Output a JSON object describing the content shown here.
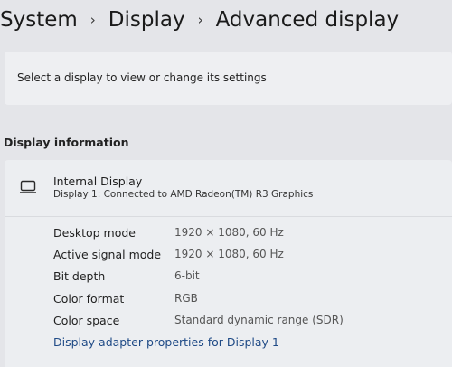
{
  "breadcrumb": {
    "items": [
      "System",
      "Display",
      "Advanced display"
    ],
    "separator": "›"
  },
  "select_card": {
    "text": "Select a display to view or change its settings"
  },
  "display_info": {
    "section_title": "Display information",
    "icon": "monitor-icon",
    "name": "Internal Display",
    "description": "Display 1: Connected to AMD Radeon(TM) R3 Graphics",
    "rows": [
      {
        "label": "Desktop mode",
        "value": "1920 × 1080, 60 Hz"
      },
      {
        "label": "Active signal mode",
        "value": "1920 × 1080, 60 Hz"
      },
      {
        "label": "Bit depth",
        "value": "6-bit"
      },
      {
        "label": "Color format",
        "value": "RGB"
      },
      {
        "label": "Color space",
        "value": "Standard dynamic range (SDR)"
      }
    ],
    "adapter_link": "Display adapter properties for Display 1"
  },
  "colors": {
    "background": "#e4e5e9",
    "card": "#eceef1",
    "link": "#1f4a86"
  }
}
